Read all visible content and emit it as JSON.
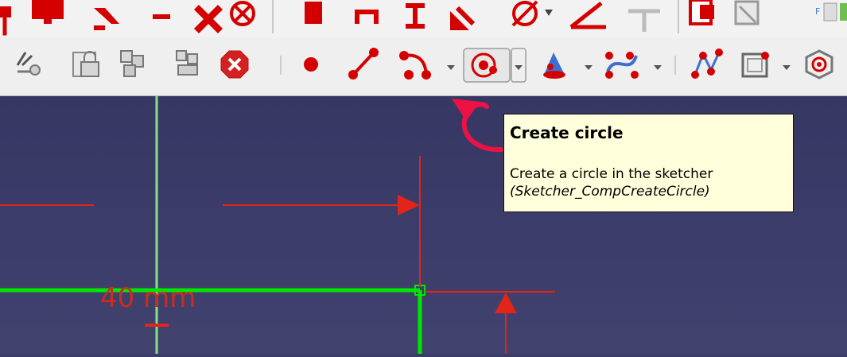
{
  "tooltip": {
    "title": "Create circle",
    "description": "Create a circle in the sketcher",
    "command": "(Sketcher_CompCreateCircle)"
  },
  "dimension": {
    "label": "40 mm"
  },
  "toolbar_top": {
    "icons": [
      "constraint-vertical-icon",
      "constraint-angle-icon",
      "constraint-equal-icon",
      "constraint-symmetric-icon",
      "constraint-block-icon",
      "constraint-distance-icon",
      "constraint-horizontal-distance-icon",
      "constraint-vertical-distance-icon",
      "constraint-point-on-object-icon",
      "constraint-radius-icon",
      "constraint-angle-dimension-icon",
      "constraint-snell-icon",
      "constraint-internal-alignment-icon",
      "toggle-construction-icon",
      "expand-icon"
    ]
  },
  "toolbar_sketcher": {
    "icons": [
      "select-constraints-icon",
      "view-sketch-lock-icon",
      "select-conflicting-icon",
      "select-redundant-icon",
      "delete-icon",
      "point-icon",
      "line-icon",
      "arc-icon",
      "circle-icon",
      "conic-icon",
      "bspline-icon",
      "polyline-icon",
      "rectangle-icon",
      "polygon-icon"
    ],
    "active": "circle-icon"
  },
  "colors": {
    "canvas": "#3c3c68",
    "axis_line": "#82e682",
    "sketch_line": "#00e600",
    "dimension": "#e32418",
    "tooltip_bg": "#ffffdc",
    "annotation_arrow": "#ee1144"
  }
}
